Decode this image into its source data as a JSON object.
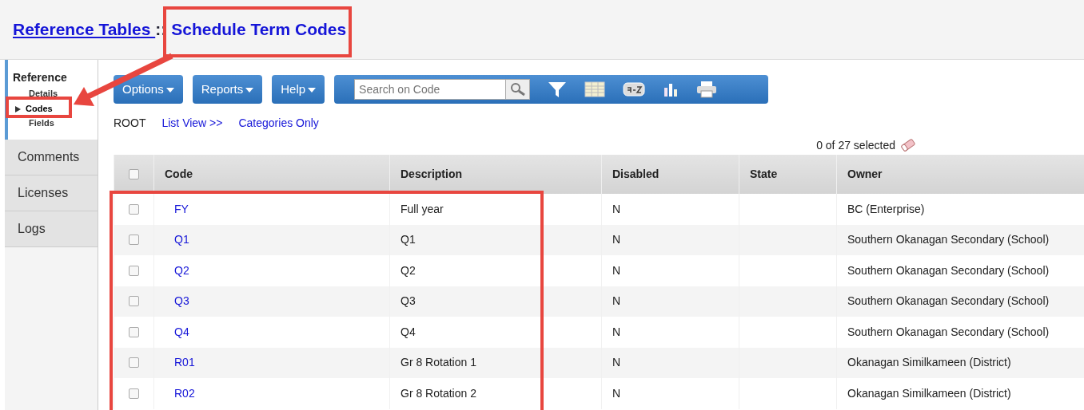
{
  "title": {
    "parent_link": "Reference Tables ",
    "separator": "::",
    "current": "Schedule Term Codes"
  },
  "sidebar": {
    "heading": "Reference",
    "items": [
      {
        "label": "Details",
        "selected": false
      },
      {
        "label": "Codes",
        "selected": true
      },
      {
        "label": "Fields",
        "selected": false
      }
    ],
    "tabs": [
      "Comments",
      "Licenses",
      "Logs"
    ]
  },
  "toolbar": {
    "menus": [
      "Options",
      "Reports",
      "Help"
    ],
    "search": {
      "placeholder": "Search on Code"
    }
  },
  "breadcrumb": {
    "root": "ROOT",
    "links": [
      "List View >>",
      "Categories Only"
    ]
  },
  "selection_count": "0 of 27 selected",
  "table": {
    "header_checked": false,
    "columns": [
      "Code",
      "Description",
      "Disabled",
      "State",
      "Owner"
    ],
    "rows": [
      {
        "checked": false,
        "code": "FY",
        "description": "Full year",
        "disabled": "N",
        "owner": "BC (Enterprise)"
      },
      {
        "checked": false,
        "code": "Q1",
        "description": "Q1",
        "disabled": "N",
        "owner": "Southern Okanagan Secondary (School)"
      },
      {
        "checked": false,
        "code": "Q2",
        "description": "Q2",
        "disabled": "N",
        "owner": "Southern Okanagan Secondary (School)"
      },
      {
        "checked": false,
        "code": "Q3",
        "description": "Q3",
        "disabled": "N",
        "owner": "Southern Okanagan Secondary (School)"
      },
      {
        "checked": false,
        "code": "Q4",
        "description": "Q4",
        "disabled": "N",
        "owner": "Southern Okanagan Secondary (School)"
      },
      {
        "checked": false,
        "code": "R01",
        "description": "Gr 8 Rotation 1",
        "disabled": "N",
        "owner": "Okanagan Similkameen (District)"
      },
      {
        "checked": false,
        "code": "R02",
        "description": "Gr 8 Rotation 2",
        "disabled": "N",
        "owner": "Okanagan Similkameen (District)"
      }
    ]
  }
}
